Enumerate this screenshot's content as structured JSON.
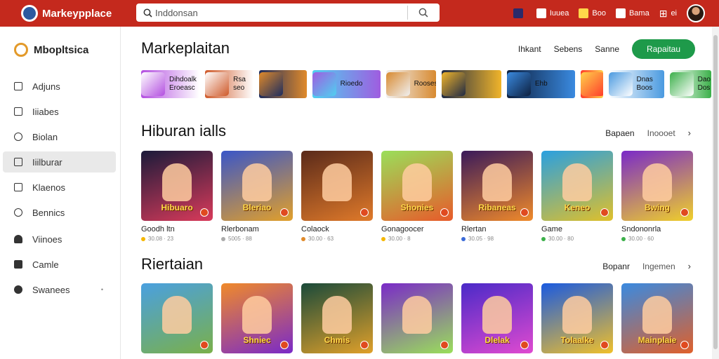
{
  "topbar": {
    "brand": "Markeypplace",
    "search_placeholder": "Inddonsan",
    "actions": [
      {
        "label": "",
        "icon": "game-icon"
      },
      {
        "label": "Iuuea",
        "icon": "store-icon"
      },
      {
        "label": "Boo",
        "icon": "gift-icon"
      },
      {
        "label": "Bama",
        "icon": "bag-icon"
      },
      {
        "label": "ei",
        "icon": "grid-icon"
      }
    ]
  },
  "sidebar": {
    "brand": "Mbopltsica",
    "items": [
      {
        "label": "Adjuns",
        "icon": "apps-icon"
      },
      {
        "label": "Iiiabes",
        "icon": "library-icon"
      },
      {
        "label": "Biolan",
        "icon": "compass-icon"
      },
      {
        "label": "Iiilburar",
        "icon": "games-icon",
        "active": true
      },
      {
        "label": "Klaenos",
        "icon": "book-icon"
      },
      {
        "label": "Bennics",
        "icon": "settings-icon"
      },
      {
        "label": "Viinoes",
        "icon": "user-icon"
      },
      {
        "label": "Camle",
        "icon": "home-icon"
      },
      {
        "label": "Swanees",
        "icon": "puzzle-icon",
        "chevron": "•"
      }
    ]
  },
  "header": {
    "title": "Markeplaitan",
    "links": [
      "Ihkant",
      "Sebens",
      "Sanne"
    ],
    "primary_button": "Rapaitau"
  },
  "featured": [
    {
      "title": "Dihdoalk",
      "subtitle": "Eroeasc",
      "color1": "#b34fe0",
      "color2": "#ffffff",
      "width": 84
    },
    {
      "title": "",
      "subtitle": "Rsa seo",
      "color1": "#cf5a2a",
      "color2": "#ffffff",
      "width": 70
    },
    {
      "title": "",
      "subtitle": "",
      "color1": "#1d2c5e",
      "color2": "#e08a2a",
      "width": 68
    },
    {
      "title": "Rioedo",
      "subtitle": "",
      "color1": "#4fd0f0",
      "color2": "#9f5de0",
      "width": 98
    },
    {
      "title": "Rooses",
      "subtitle": "",
      "color1": "#f0f0f0",
      "color2": "#d88a30",
      "width": 72
    },
    {
      "title": "",
      "subtitle": "",
      "color1": "#1f2a44",
      "color2": "#f0b42a",
      "width": 86
    },
    {
      "title": "Ehb",
      "subtitle": "",
      "color1": "#0d2040",
      "color2": "#3a8ae0",
      "width": 98
    },
    {
      "title": "",
      "subtitle": "",
      "color1": "#ff3b2b",
      "color2": "#ffd14a",
      "width": 32
    },
    {
      "title": "Dnas Boos",
      "subtitle": "",
      "color1": "#ffffff",
      "color2": "#4a9ae0",
      "width": 80
    },
    {
      "title": "Dao",
      "subtitle": "Dos",
      "color1": "#ffffff",
      "color2": "#3cb04a",
      "width": 60
    }
  ],
  "sections": [
    {
      "title": "Hiburan ialls",
      "links": [
        "Bapaen",
        "Inoooet"
      ],
      "cards": [
        {
          "name": "Goodh ltn",
          "meta": "30.08 · 23",
          "word": "Hibuaro",
          "c1": "#1b1b3a",
          "c2": "#d93a5a",
          "dot": "#f5b700"
        },
        {
          "name": "Rlerbonam",
          "meta": "5005 · 88",
          "word": "Bleriao",
          "c1": "#3a56c8",
          "c2": "#e2a02a",
          "dot": "#aaaaaa"
        },
        {
          "name": "Colaock",
          "meta": "30.00 · 63",
          "word": "",
          "c1": "#5a2a1a",
          "c2": "#e07a2a",
          "dot": "#e08a2a"
        },
        {
          "name": "Gonagoocer",
          "meta": "30.00 · 8",
          "word": "Shonies",
          "c1": "#9adf5a",
          "c2": "#e85a2a",
          "dot": "#f5b700"
        },
        {
          "name": "Rlertan",
          "meta": "30.05 · 98",
          "word": "Ribaneas",
          "c1": "#3a1a5a",
          "c2": "#f08a2a",
          "dot": "#3a6ad8"
        },
        {
          "name": "Game",
          "meta": "30.00 · 80",
          "word": "Keneo",
          "c1": "#2aa0e0",
          "c2": "#e0c02a",
          "dot": "#3cb04a"
        },
        {
          "name": "Sndononrla",
          "meta": "30.00 · 60",
          "word": "Bwing",
          "c1": "#7a2ac8",
          "c2": "#f0d02a",
          "dot": "#3cb04a"
        }
      ]
    },
    {
      "title": "Riertaian",
      "links": [
        "Bopanr",
        "Ingemen"
      ],
      "cards": [
        {
          "name": "",
          "meta": "",
          "word": "",
          "c1": "#4aa0e0",
          "c2": "#7ab04a",
          "dot": "#aaaaaa"
        },
        {
          "name": "",
          "meta": "",
          "word": "Shniec",
          "c1": "#f08a2a",
          "c2": "#7a2ac8",
          "dot": "#aaaaaa"
        },
        {
          "name": "",
          "meta": "",
          "word": "Chmis",
          "c1": "#1a4a3a",
          "c2": "#e0a02a",
          "dot": "#aaaaaa"
        },
        {
          "name": "",
          "meta": "",
          "word": "",
          "c1": "#7a2ac8",
          "c2": "#9adf5a",
          "dot": "#aaaaaa"
        },
        {
          "name": "",
          "meta": "",
          "word": "Dlelak",
          "c1": "#4a2ac8",
          "c2": "#e04ad0",
          "dot": "#aaaaaa"
        },
        {
          "name": "",
          "meta": "",
          "word": "Tolaalke",
          "c1": "#1a5ae0",
          "c2": "#f0c02a",
          "dot": "#aaaaaa"
        },
        {
          "name": "",
          "meta": "",
          "word": "Mainplaie",
          "c1": "#3a8ae0",
          "c2": "#e0602a",
          "dot": "#aaaaaa"
        }
      ]
    }
  ]
}
